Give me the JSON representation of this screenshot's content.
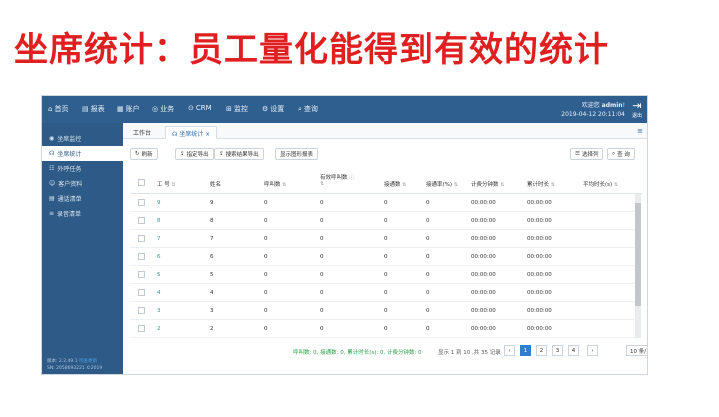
{
  "headline": "坐席统计：员工量化能得到有效的统计",
  "topnav": {
    "items": [
      {
        "icon": "⌂",
        "label": "首页"
      },
      {
        "icon": "▤",
        "label": "报表"
      },
      {
        "icon": "▦",
        "label": "账户"
      },
      {
        "icon": "◎",
        "label": "业务"
      },
      {
        "icon": "⊙",
        "label": "CRM"
      },
      {
        "icon": "⊞",
        "label": "监控"
      },
      {
        "icon": "⚙",
        "label": "设置"
      },
      {
        "icon": "⌕",
        "label": "查询"
      }
    ],
    "welcome_prefix": "欢迎您",
    "user": "admin",
    "welcome_suffix": "!",
    "datetime": "2019-04-12 20:11:04",
    "logout_label": "退出"
  },
  "sidebar": {
    "items": [
      {
        "icon": "◉",
        "label": "坐席监控"
      },
      {
        "icon": "☊",
        "label": "坐席统计"
      },
      {
        "icon": "☷",
        "label": "外呼任务"
      },
      {
        "icon": "☺",
        "label": "客户资料"
      },
      {
        "icon": "▤",
        "label": "通话清单"
      },
      {
        "icon": "≡",
        "label": "录音清单"
      }
    ],
    "active_index": 1,
    "footer_line1_prefix": "版本: 2.2.49.1",
    "footer_line1_link": "检查更新",
    "footer_line2": "SN: 2058693221   ©2019"
  },
  "tabs": [
    {
      "label": "工作台"
    },
    {
      "label": "☊ 坐席统计 ×"
    }
  ],
  "tab_menu_icon": "≡",
  "toolbar": {
    "refresh": "刷新",
    "export_selected": "指定导出",
    "export_results": "搜索结果导出",
    "show_chart": "显示图形报表",
    "choose_columns": "选择列",
    "search": "查 询"
  },
  "table": {
    "columns": [
      "工 号",
      "姓名",
      "呼叫数",
      "有效呼叫数",
      "接通数",
      "接通率(%)",
      "计费分钟数",
      "累计时长",
      "平均时长(s)"
    ],
    "rows": [
      [
        "9",
        "9",
        "0",
        "0",
        "0",
        "0",
        "00:00:00",
        "00:00:00",
        ""
      ],
      [
        "8",
        "8",
        "0",
        "0",
        "0",
        "0",
        "00:00:00",
        "00:00:00",
        ""
      ],
      [
        "7",
        "7",
        "0",
        "0",
        "0",
        "0",
        "00:00:00",
        "00:00:00",
        ""
      ],
      [
        "6",
        "6",
        "0",
        "0",
        "0",
        "0",
        "00:00:00",
        "00:00:00",
        ""
      ],
      [
        "5",
        "5",
        "0",
        "0",
        "0",
        "0",
        "00:00:00",
        "00:00:00",
        ""
      ],
      [
        "4",
        "4",
        "0",
        "0",
        "0",
        "0",
        "00:00:00",
        "00:00:00",
        ""
      ],
      [
        "3",
        "3",
        "0",
        "0",
        "0",
        "0",
        "00:00:00",
        "00:00:00",
        ""
      ],
      [
        "2",
        "2",
        "0",
        "0",
        "0",
        "0",
        "00:00:00",
        "00:00:00",
        ""
      ]
    ]
  },
  "footer": {
    "summary": "呼叫数: 0, 接通数: 0, 累计时长(s): 0, 计费分钟数: 0",
    "page_info": "显示 1 到 10 ,共 35 记录",
    "pages": [
      "‹",
      "1",
      "2",
      "3",
      "4",
      "›"
    ],
    "active_page": "1",
    "page_size": "10 条/页 ▾"
  }
}
